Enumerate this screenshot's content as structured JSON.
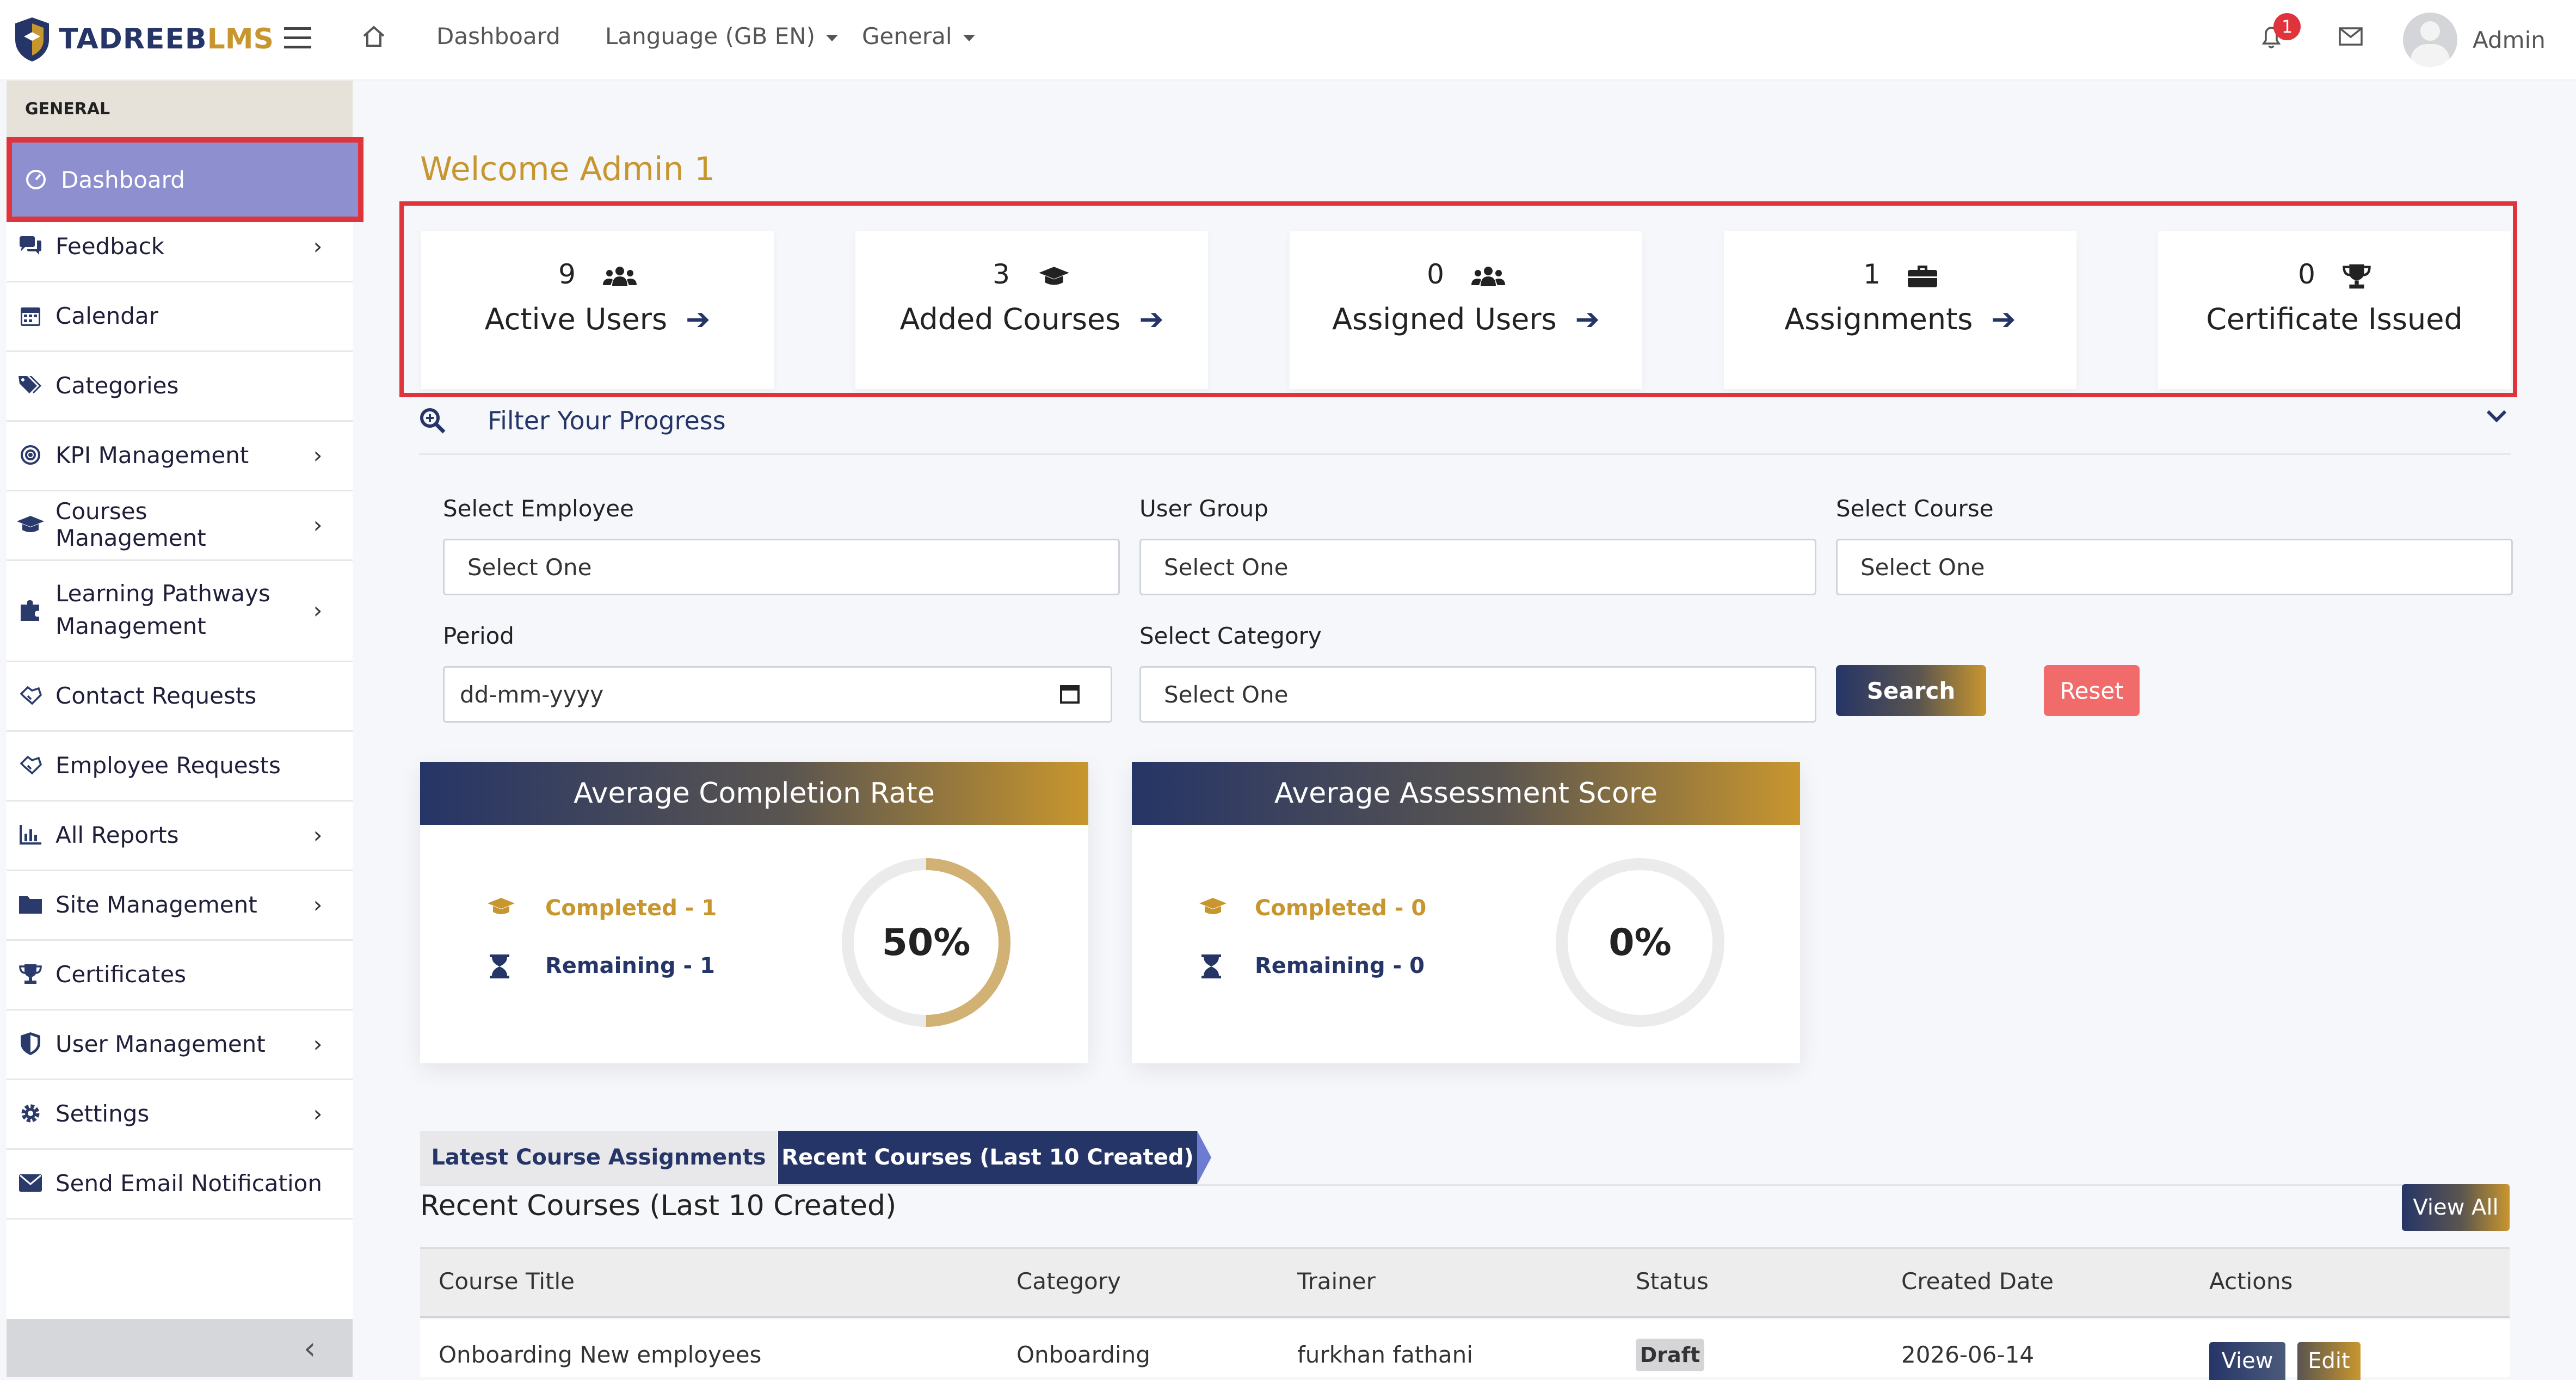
{
  "brand": {
    "name_a": "TADREEB",
    "name_b": "LMS"
  },
  "topbar": {
    "nav_dashboard": "Dashboard",
    "nav_language": "Language (GB EN)",
    "nav_general": "General",
    "notification_count": "1",
    "user_name": "Admin"
  },
  "sidebar": {
    "section": "GENERAL",
    "items": [
      {
        "label": "Dashboard",
        "icon": "dashboard-icon"
      },
      {
        "label": "Feedback",
        "icon": "comments-icon"
      },
      {
        "label": "Calendar",
        "icon": "calendar-icon"
      },
      {
        "label": "Categories",
        "icon": "tags-icon"
      },
      {
        "label": "KPI Management",
        "icon": "target-icon"
      },
      {
        "label": "Courses Management",
        "icon": "graduation-cap-icon"
      },
      {
        "label": "Learning Pathways",
        "label2": "Management",
        "icon": "puzzle-icon"
      },
      {
        "label": "Contact Requests",
        "icon": "handshake-icon"
      },
      {
        "label": "Employee Requests",
        "icon": "handshake-icon"
      },
      {
        "label": "All Reports",
        "icon": "chart-bar-icon"
      },
      {
        "label": "Site Management",
        "icon": "folder-icon"
      },
      {
        "label": "Certificates",
        "icon": "trophy-icon"
      },
      {
        "label": "User Management",
        "icon": "shield-icon"
      },
      {
        "label": "Settings",
        "icon": "gear-icon"
      },
      {
        "label": "Send Email Notification",
        "icon": "envelope-icon"
      }
    ]
  },
  "main": {
    "welcome": "Welcome Admin 1",
    "stats": [
      {
        "value": "9",
        "label": "Active Users",
        "icon": "users-icon"
      },
      {
        "value": "3",
        "label": "Added Courses",
        "icon": "graduation-cap-icon"
      },
      {
        "value": "0",
        "label": "Assigned Users",
        "icon": "users-icon"
      },
      {
        "value": "1",
        "label": "Assignments",
        "icon": "briefcase-icon"
      },
      {
        "value": "0",
        "label": "Certificate Issued",
        "icon": "trophy-icon"
      }
    ],
    "filter": {
      "title": "Filter Your Progress",
      "select_employee_label": "Select Employee",
      "select_employee_value": "Select One",
      "user_group_label": "User Group",
      "user_group_value": "Select One",
      "select_course_label": "Select Course",
      "select_course_value": "Select One",
      "period_label": "Period",
      "period_placeholder": "dd-mm-yyyy",
      "select_category_label": "Select Category",
      "select_category_value": "Select One",
      "search_label": "Search",
      "reset_label": "Reset"
    },
    "completion": {
      "title": "Average Completion Rate",
      "completed": "Completed - 1",
      "remaining": "Remaining - 1",
      "percent_label": "50%",
      "percent": 50
    },
    "assessment": {
      "title": "Average Assessment Score",
      "completed": "Completed - 0",
      "remaining": "Remaining - 0",
      "percent_label": "0%",
      "percent": 0
    },
    "tabs": {
      "tab1": "Latest Course Assignments",
      "tab2": "Recent Courses (Last 10 Created)"
    },
    "recent": {
      "heading": "Recent Courses (Last 10 Created)",
      "view_all": "View All",
      "columns": [
        "Course Title",
        "Category",
        "Trainer",
        "Status",
        "Created Date",
        "Actions"
      ],
      "rows": [
        {
          "title": "Onboarding New employees",
          "category": "Onboarding",
          "trainer": "furkhan fathani",
          "status": "Draft",
          "date": "2026-06-14",
          "view": "View",
          "edit": "Edit"
        }
      ]
    }
  },
  "colors": {
    "accent": "#c8962e",
    "navy": "#263567",
    "danger": "#e0343c",
    "reset": "#f26b6b"
  }
}
